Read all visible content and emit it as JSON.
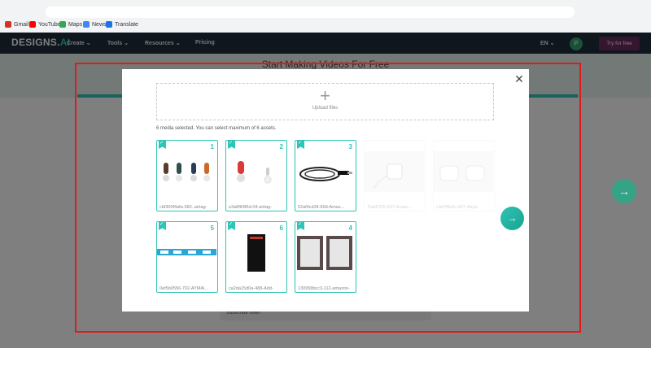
{
  "bookmarks": [
    "Gmail",
    "YouTube",
    "Maps",
    "News",
    "Translate"
  ],
  "site": {
    "logo_main": "DESIGNS.",
    "logo_ai": "AI",
    "nav": [
      "Create",
      "Tools",
      "Resources",
      "Pricing"
    ],
    "language": "EN",
    "avatar_letter": "P",
    "try_free": "Try for free",
    "hero_title": "Start Making Videos For Free",
    "subscribe": "Subscribe Now!"
  },
  "modal": {
    "upload_label": "Upload files",
    "selection_text": "6 media selected. You can select maximum of 6 assets.",
    "cards": [
      {
        "num": "1",
        "name": "cbf300f4afa-582..airtag-",
        "selected": true
      },
      {
        "num": "2",
        "name": "e3a8f84f6d-04-airtag-",
        "selected": true
      },
      {
        "num": "3",
        "name": "52af4cd34-60d-Amaz...",
        "selected": true
      },
      {
        "num": "",
        "name": "7fa6f7f05-607-Amaz...",
        "selected": false
      },
      {
        "num": "",
        "name": "c3d7f8c5c-607-Airpo...",
        "selected": false
      },
      {
        "num": "5",
        "name": "0ef5b0556-792-AYMAI...",
        "selected": true
      },
      {
        "num": "6",
        "name": "ca2da15d0a-488-Add-",
        "selected": true
      },
      {
        "num": "4",
        "name": "130958bcc3-112-amazon-",
        "selected": true
      }
    ]
  },
  "colors": {
    "accent": "#2ec4b6",
    "nav_bg": "#1f2d3d",
    "try_btn": "#6b2d5c",
    "annotation": "#e01b1b"
  }
}
